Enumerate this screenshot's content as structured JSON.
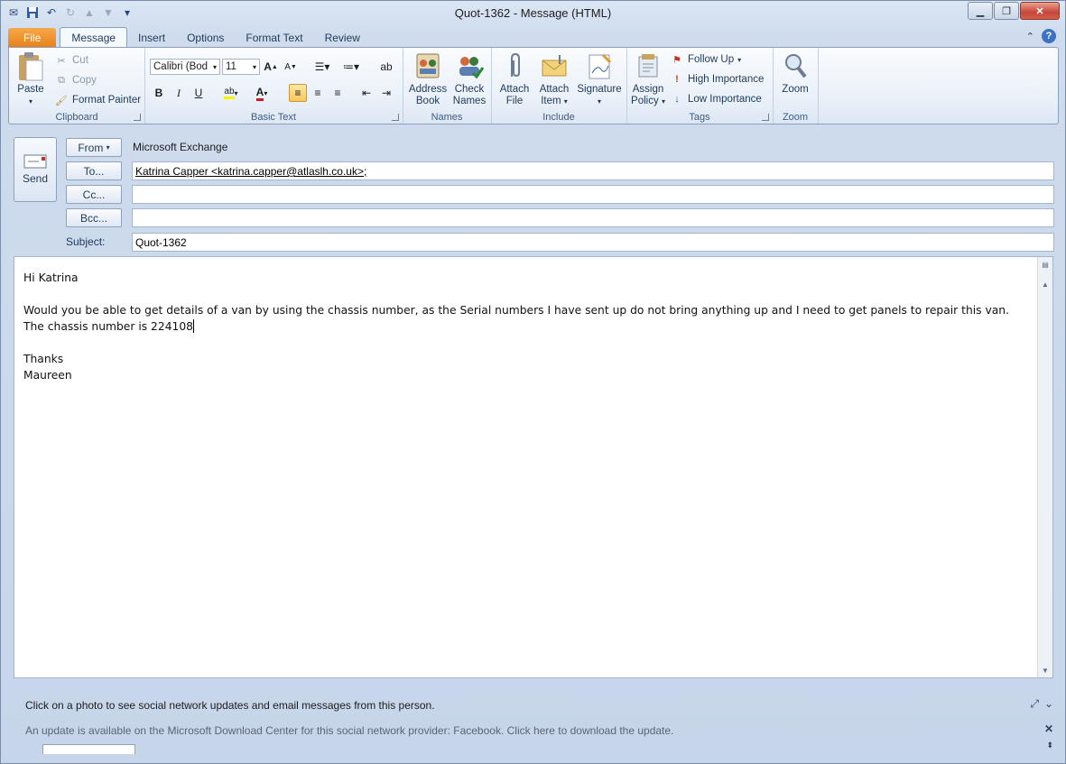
{
  "window": {
    "title": "Quot-1362  -  Message (HTML)"
  },
  "ribbon": {
    "tabs": [
      {
        "label": "File"
      },
      {
        "label": "Message"
      },
      {
        "label": "Insert"
      },
      {
        "label": "Options"
      },
      {
        "label": "Format Text"
      },
      {
        "label": "Review"
      }
    ],
    "clipboard": {
      "label": "Clipboard",
      "paste": "Paste",
      "cut": "Cut",
      "copy": "Copy",
      "format_painter": "Format Painter"
    },
    "basic_text": {
      "label": "Basic Text",
      "font": "Calibri (Bod",
      "size": "11"
    },
    "names": {
      "label": "Names",
      "address_book_1": "Address",
      "address_book_2": "Book",
      "check_names_1": "Check",
      "check_names_2": "Names"
    },
    "include": {
      "label": "Include",
      "attach_file_1": "Attach",
      "attach_file_2": "File",
      "attach_item_1": "Attach",
      "attach_item_2": "Item",
      "signature": "Signature"
    },
    "tags": {
      "label": "Tags",
      "assign_policy_1": "Assign",
      "assign_policy_2": "Policy",
      "follow_up": "Follow Up",
      "high_importance": "High Importance",
      "low_importance": "Low Importance"
    },
    "zoom": {
      "label": "Zoom",
      "zoom": "Zoom"
    }
  },
  "header": {
    "send": "Send",
    "from_button": "From",
    "from_value": "Microsoft Exchange",
    "to_button": "To...",
    "to_value": "Katrina Capper  <katrina.capper@atlaslh.co.uk>;",
    "cc_button": "Cc...",
    "cc_value": "",
    "bcc_button": "Bcc...",
    "bcc_value": "",
    "subject_label": "Subject:",
    "subject_value": "Quot-1362"
  },
  "body": {
    "greeting": "Hi Katrina",
    "paragraph": "Would you be able to get details of a van by using the chassis number, as the Serial numbers I have sent up do not bring anything up and I need to get panels to repair this van.  The chassis number is 224108",
    "signoff": "Thanks",
    "signature": "Maureen"
  },
  "people_pane": {
    "info": "Click on a photo to see social network updates and email messages from this person.",
    "update": "An update is available on the Microsoft Download Center for this social network provider: Facebook. Click here to download the update."
  }
}
